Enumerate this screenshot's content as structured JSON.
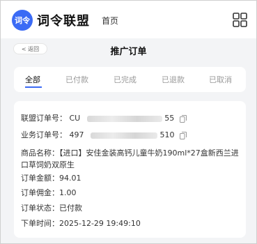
{
  "header": {
    "logo_text": "词令",
    "brand": "词令联盟",
    "nav_home": "首页"
  },
  "subheader": {
    "back_label": "< 返回",
    "title": "推广订单"
  },
  "tabs": [
    {
      "label": "全部",
      "active": true
    },
    {
      "label": "已付款",
      "active": false
    },
    {
      "label": "已完成",
      "active": false
    },
    {
      "label": "已退款",
      "active": false
    },
    {
      "label": "已取消",
      "active": false
    }
  ],
  "order": {
    "union_order_label": "联盟订单号：",
    "union_order_prefix": "CU",
    "union_order_suffix": "55",
    "business_order_label": "业务订单号：",
    "business_order_prefix": "497",
    "business_order_suffix": "510",
    "goods_label": "商品名称：",
    "goods_name": "【进口】安佳金装高钙儿童牛奶190ml*27盒新西兰进口草饲奶双原生",
    "amount_label": "订单金额：",
    "amount": "94.01",
    "commission_label": "订单佣金：",
    "commission": "1.00",
    "status_label": "订单状态：",
    "status": "已付款",
    "time_label": "下单时间：",
    "time": "2025-12-29 19:49:10"
  },
  "colors": {
    "accent": "#3b6bf5",
    "background": "#f3f4f6",
    "card": "#ffffff"
  }
}
